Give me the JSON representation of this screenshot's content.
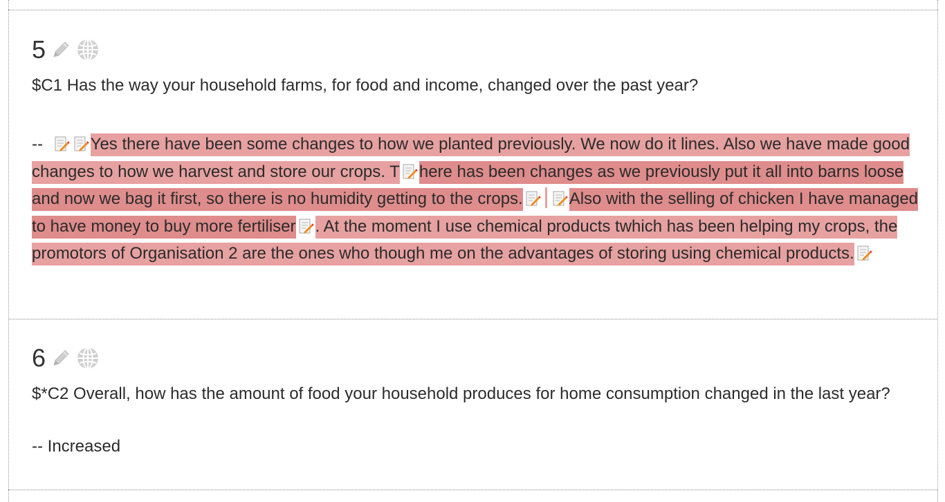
{
  "questions": [
    {
      "number": "5",
      "text": "$C1 Has the way your household farms, for food and income, changed over the past year?",
      "answer_prefix": "--",
      "answer_segments": [
        "Yes there have been some changes to how we planted previously. We now do it lines. Also we have made good changes to how we harvest and store our crops. T",
        "here has been changes as we previously put it all into barns loose and now we bag it first, so there is no humidity getting to the crops.",
        "Also with the selling of chicken I have managed to have money to buy more fertiliser",
        ". At the moment I use chemical products twhich has been helping my crops, the promotors of Organisation 2 are the ones who though me on the advantages of storing using chemical products."
      ],
      "icons": [
        "pencil-icon",
        "globe-icon",
        "memo-icon"
      ]
    },
    {
      "number": "6",
      "text": "$*C2 Overall, how has the amount of food your household produces for home consumption changed in the last year?",
      "answer": "-- Increased",
      "icons": [
        "pencil-icon",
        "globe-icon"
      ]
    }
  ],
  "colors": {
    "highlight": "#e7a1a1",
    "highlight_dark": "#df8c8c",
    "icon_gray": "#c8c8c8",
    "text": "#2b2b2b"
  }
}
